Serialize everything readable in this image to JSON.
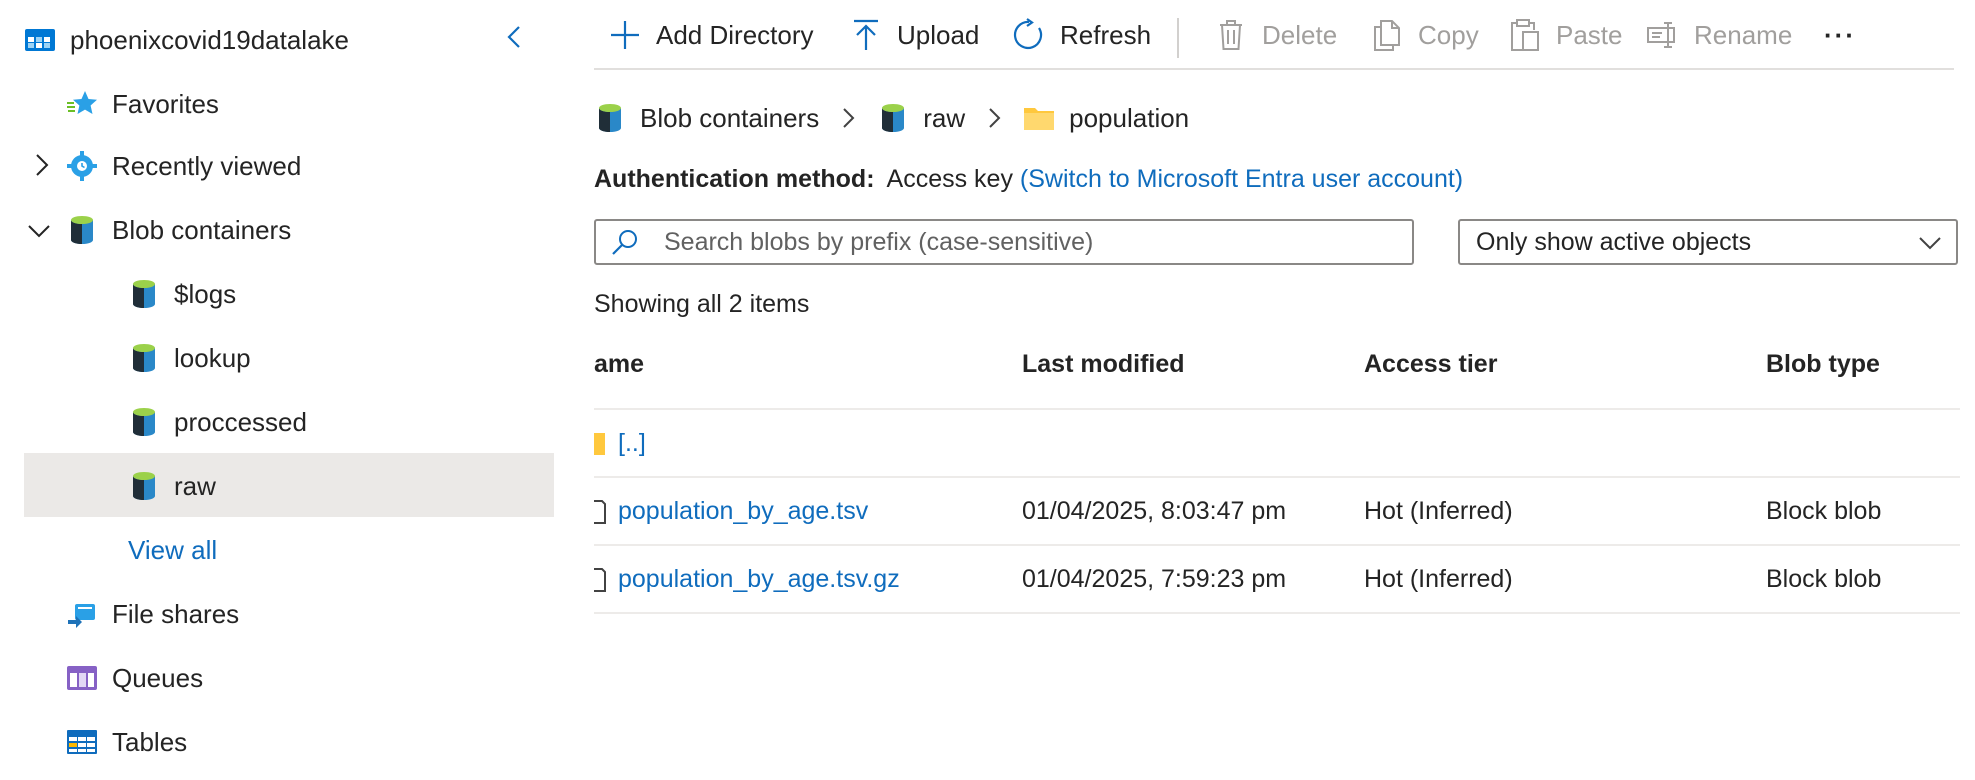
{
  "sidebar": {
    "account_name": "phoenixcovid19datalake",
    "items": [
      {
        "label": "Favorites",
        "icon": "favorites-star-icon"
      },
      {
        "label": "Recently viewed",
        "icon": "recently-viewed-gear-icon"
      },
      {
        "label": "Blob containers",
        "icon": "blob-container-icon"
      }
    ],
    "containers": [
      "$logs",
      "lookup",
      "proccessed",
      "raw"
    ],
    "selected_container": "raw",
    "view_all": "View all",
    "other_items": [
      {
        "label": "File shares",
        "icon": "file-share-icon"
      },
      {
        "label": "Queues",
        "icon": "queue-icon"
      },
      {
        "label": "Tables",
        "icon": "table-icon"
      }
    ]
  },
  "toolbar": {
    "add_directory": "Add Directory",
    "upload": "Upload",
    "refresh": "Refresh",
    "delete": "Delete",
    "copy": "Copy",
    "paste": "Paste",
    "rename": "Rename",
    "more": "···"
  },
  "breadcrumb": [
    "Blob containers",
    "raw",
    "population"
  ],
  "auth": {
    "label": "Authentication method:",
    "value": "Access key",
    "switch_link": "(Switch to Microsoft Entra user account)"
  },
  "search": {
    "placeholder": "Search blobs by prefix (case-sensitive)",
    "value": ""
  },
  "filter": {
    "selected": "Only show active objects"
  },
  "item_count": "Showing all 2 items",
  "table": {
    "columns": [
      "ame",
      "Last modified",
      "Access tier",
      "Blob type"
    ],
    "parent_row": "[..]",
    "rows": [
      {
        "name": "population_by_age.tsv",
        "modified": "01/04/2025, 8:03:47 pm",
        "tier": "Hot (Inferred)",
        "type": "Block blob"
      },
      {
        "name": "population_by_age.tsv.gz",
        "modified": "01/04/2025, 7:59:23 pm",
        "tier": "Hot (Inferred)",
        "type": "Block blob"
      }
    ]
  },
  "colors": {
    "link": "#0f6cbd",
    "selected_bg": "#ebe9e7",
    "folder": "#ffc83d",
    "disabled": "#a19f9d"
  }
}
